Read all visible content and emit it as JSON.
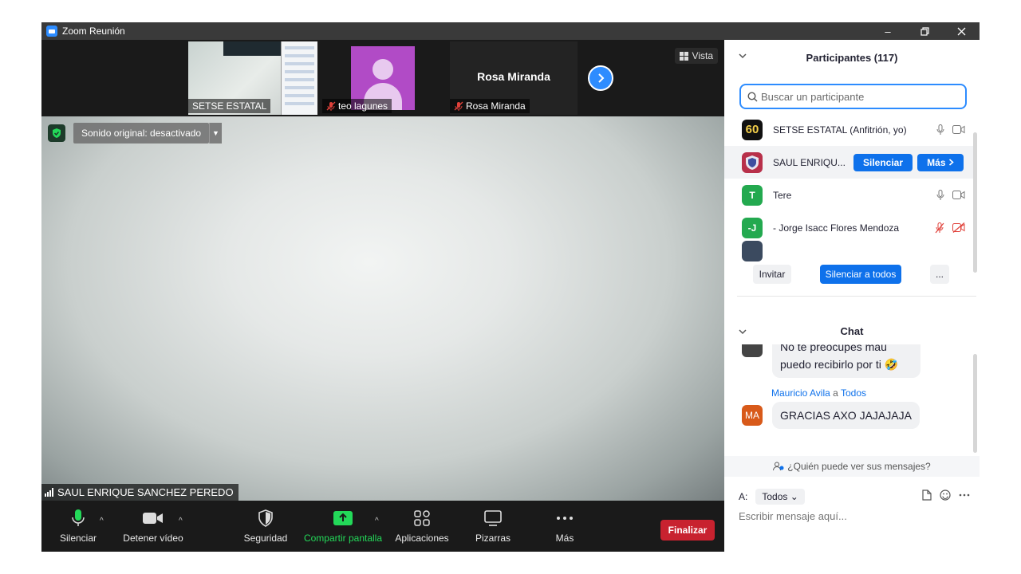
{
  "window": {
    "title": "Zoom Reunión"
  },
  "strip": {
    "thumbnails": [
      {
        "name": "SETSE ESTATAL",
        "muted": false
      },
      {
        "name": "teo lagunes",
        "muted": true
      },
      {
        "name": "Rosa Miranda",
        "muted": true,
        "big_label": "Rosa Miranda"
      }
    ],
    "view_label": "Vista"
  },
  "main_video": {
    "sound_label": "Sonido original: desactivado",
    "speaker": "SAUL ENRIQUE SANCHEZ PEREDO"
  },
  "toolbar": {
    "mute": "Silenciar",
    "video": "Detener vídeo",
    "security": "Seguridad",
    "share": "Compartir pantalla",
    "apps": "Aplicaciones",
    "whiteboards": "Pizarras",
    "more": "Más",
    "end": "Finalizar"
  },
  "participants": {
    "title": "Participantes (117)",
    "search_placeholder": "Buscar un participante",
    "list": [
      {
        "name": "SETSE ESTATAL (Anfitrión, yo)",
        "avatar": "60",
        "avatar_color": "#111111"
      },
      {
        "name": "SAUL ENRIQU...",
        "avatar": "",
        "avatar_color": "#b8304a",
        "mute_btn": "Silenciar",
        "more_btn": "Más"
      },
      {
        "name": "Tere",
        "avatar": "T",
        "avatar_color": "#23a94f"
      },
      {
        "name": "- Jorge Isacc Flores Mendoza",
        "avatar": "-J",
        "avatar_color": "#23a94f"
      }
    ],
    "invite": "Invitar",
    "mute_all": "Silenciar a todos",
    "more": "..."
  },
  "chat": {
    "title": "Chat",
    "messages": [
      {
        "line1": "No te preocupes mau",
        "line2": "puedo recibirlo por ti",
        "emoji": "🤣"
      },
      {
        "from": "Mauricio Avila",
        "to_word": "a",
        "to": "Todos",
        "avatar": "MA",
        "avatar_color": "#d85a1a",
        "text": "GRACIAS  AXO JAJAJAJA"
      }
    ],
    "who_sees": "¿Quién puede ver sus mensajes?",
    "to_label": "A:",
    "to_value": "Todos",
    "input_placeholder": "Escribir mensaje aquí..."
  }
}
